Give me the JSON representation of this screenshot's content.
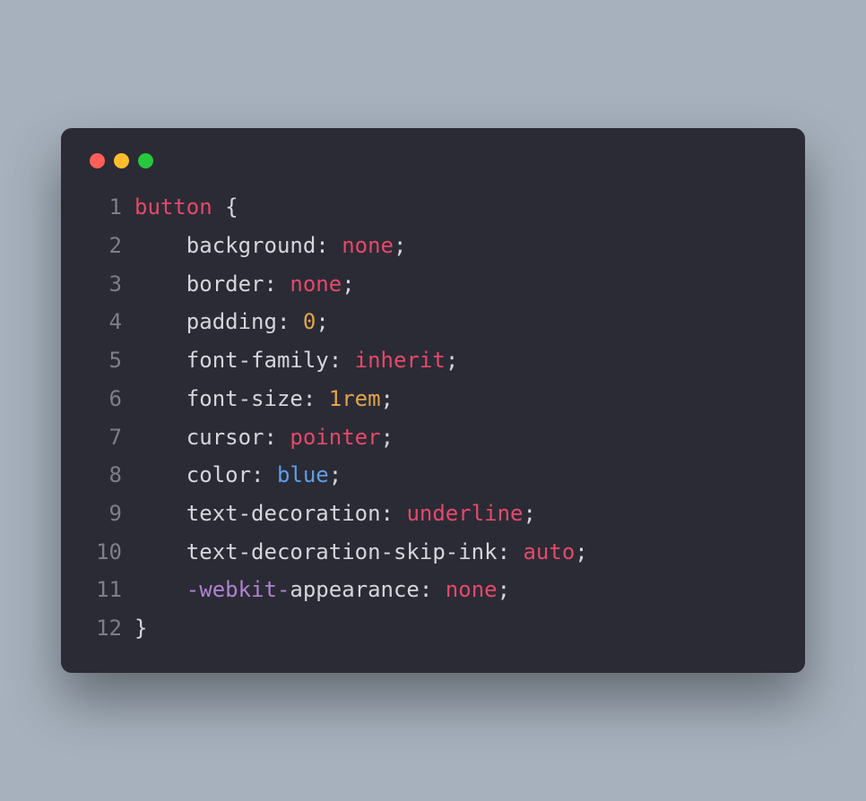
{
  "window": {
    "buttons": {
      "close": "close",
      "minimize": "minimize",
      "maximize": "maximize"
    }
  },
  "code": {
    "lines": [
      {
        "n": "1",
        "tokens": [
          [
            "button ",
            "selector"
          ],
          [
            "{",
            "punct"
          ]
        ]
      },
      {
        "n": "2",
        "tokens": [
          [
            "    ",
            "default"
          ],
          [
            "background",
            "prop"
          ],
          [
            ": ",
            "punct"
          ],
          [
            "none",
            "value"
          ],
          [
            ";",
            "punct"
          ]
        ]
      },
      {
        "n": "3",
        "tokens": [
          [
            "    ",
            "default"
          ],
          [
            "border",
            "prop"
          ],
          [
            ": ",
            "punct"
          ],
          [
            "none",
            "value"
          ],
          [
            ";",
            "punct"
          ]
        ]
      },
      {
        "n": "4",
        "tokens": [
          [
            "    ",
            "default"
          ],
          [
            "padding",
            "prop"
          ],
          [
            ": ",
            "punct"
          ],
          [
            "0",
            "number"
          ],
          [
            ";",
            "punct"
          ]
        ]
      },
      {
        "n": "5",
        "tokens": [
          [
            "    ",
            "default"
          ],
          [
            "font-family",
            "prop"
          ],
          [
            ": ",
            "punct"
          ],
          [
            "inherit",
            "value"
          ],
          [
            ";",
            "punct"
          ]
        ]
      },
      {
        "n": "6",
        "tokens": [
          [
            "    ",
            "default"
          ],
          [
            "font-size",
            "prop"
          ],
          [
            ": ",
            "punct"
          ],
          [
            "1rem",
            "number"
          ],
          [
            ";",
            "punct"
          ]
        ]
      },
      {
        "n": "7",
        "tokens": [
          [
            "    ",
            "default"
          ],
          [
            "cursor",
            "prop"
          ],
          [
            ": ",
            "punct"
          ],
          [
            "pointer",
            "value"
          ],
          [
            ";",
            "punct"
          ]
        ]
      },
      {
        "n": "8",
        "tokens": [
          [
            "    ",
            "default"
          ],
          [
            "color",
            "prop"
          ],
          [
            ": ",
            "punct"
          ],
          [
            "blue",
            "colorval"
          ],
          [
            ";",
            "punct"
          ]
        ]
      },
      {
        "n": "9",
        "tokens": [
          [
            "    ",
            "default"
          ],
          [
            "text-decoration",
            "prop"
          ],
          [
            ": ",
            "punct"
          ],
          [
            "underline",
            "value"
          ],
          [
            ";",
            "punct"
          ]
        ]
      },
      {
        "n": "10",
        "tokens": [
          [
            "    ",
            "default"
          ],
          [
            "text-decoration-skip-ink",
            "prop"
          ],
          [
            ": ",
            "punct"
          ],
          [
            "auto",
            "value"
          ],
          [
            ";",
            "punct"
          ]
        ]
      },
      {
        "n": "11",
        "tokens": [
          [
            "    ",
            "default"
          ],
          [
            "-webkit-",
            "prefix"
          ],
          [
            "appearance",
            "prop"
          ],
          [
            ": ",
            "punct"
          ],
          [
            "none",
            "value"
          ],
          [
            ";",
            "punct"
          ]
        ]
      },
      {
        "n": "12",
        "tokens": [
          [
            "}",
            "punct"
          ]
        ]
      }
    ]
  }
}
